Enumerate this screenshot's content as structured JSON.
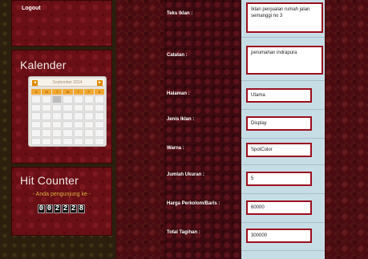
{
  "sidebar": {
    "logout_label": "Logout",
    "kalender": {
      "title": "Kalender",
      "month_label": "September 2014",
      "prev_label": "◄",
      "next_label": "►",
      "days_of_week": [
        "S",
        "M",
        "T",
        "W",
        "T",
        "F",
        "S"
      ]
    },
    "hit_counter": {
      "title": "Hit Counter",
      "subtitle": "- Anda pengunjung ke -",
      "digits": [
        "0",
        "0",
        "2",
        "2",
        "2",
        "8"
      ]
    }
  },
  "form": {
    "teks_iklan_label": "Teks Iklan :",
    "teks_iklan_value": "Iklan penjualan rumah jalan semanggi no 3",
    "catatan_label": "Catatan :",
    "catatan_value": "perumahan indrapura",
    "halaman_label": "Halaman :",
    "halaman_value": "Utama",
    "jenis_iklan_label": "Jenis Iklan :",
    "jenis_iklan_value": "Display",
    "warna_label": "Warna :",
    "warna_value": "SpotColor",
    "jumlah_ukuran_label": "Jumlah Ukuran :",
    "jumlah_ukuran_value": "5",
    "harga_label": "Harga Perkolom/Baris :",
    "harga_value": "60000",
    "total_label": "Total Tagihan :",
    "total_value": "300000"
  }
}
